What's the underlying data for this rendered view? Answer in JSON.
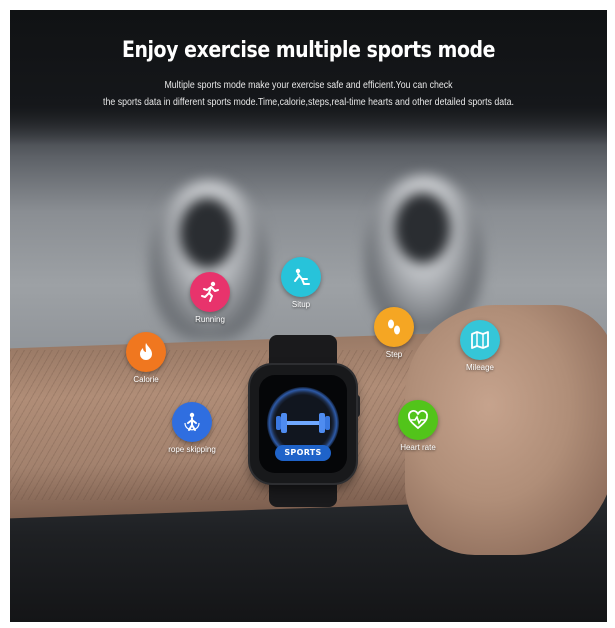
{
  "banner": {
    "headline": "Enjoy exercise multiple sports mode",
    "line1": "Multiple sports mode make your exercise safe and efficient.You can check",
    "line2": "the sports data in different sports mode.Time,calorie,steps,real-time hearts and other detailed sports data."
  },
  "watch": {
    "screen_label": "SPORTS",
    "screen_icon": "dumbbell-icon"
  },
  "sports": [
    {
      "label": "Running",
      "icon": "running-icon",
      "color": "#e8336c"
    },
    {
      "label": "Situp",
      "icon": "situp-icon",
      "color": "#27c3da"
    },
    {
      "label": "Calorie",
      "icon": "flame-icon",
      "color": "#f0771f"
    },
    {
      "label": "Step",
      "icon": "footprints-icon",
      "color": "#f5a623"
    },
    {
      "label": "Mileage",
      "icon": "map-icon",
      "color": "#35c6d8"
    },
    {
      "label": "rope skipping",
      "icon": "rope-skipping-icon",
      "color": "#2f6ee0"
    },
    {
      "label": "Heart rate",
      "icon": "heart-rate-icon",
      "color": "#52c41a"
    }
  ]
}
